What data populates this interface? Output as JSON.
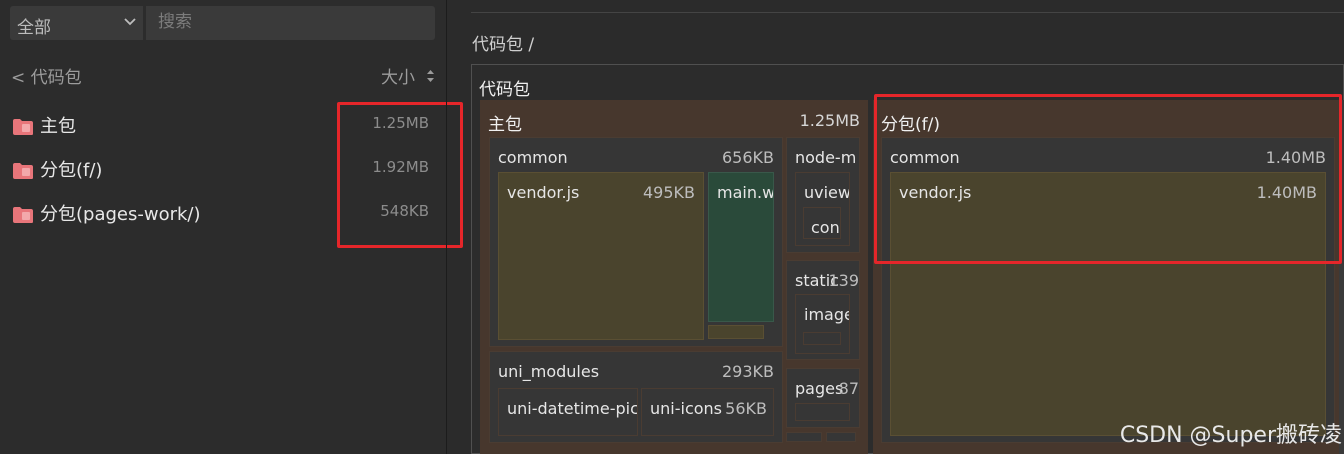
{
  "sidebar": {
    "filter_label": "全部",
    "search_placeholder": "搜索",
    "back_label": "< 代码包",
    "sort_label": "大小",
    "packages": [
      {
        "name": "主包",
        "size": "1.25MB"
      },
      {
        "name": "分包(f/)",
        "size": "1.92MB"
      },
      {
        "name": "分包(pages-work/)",
        "size": "548KB"
      }
    ]
  },
  "main": {
    "breadcrumb": "代码包 /",
    "treemap_title": "代码包",
    "main_pkg": {
      "label": "主包",
      "size": "1.25MB"
    },
    "common": {
      "label": "common",
      "size": "656KB"
    },
    "vendor": {
      "label": "vendor.js",
      "size": "495KB"
    },
    "mainw": {
      "label": "main.w"
    },
    "node_m": {
      "label": "node-m"
    },
    "uview": {
      "label": "uview"
    },
    "con": {
      "label": "con"
    },
    "static": {
      "label": "static",
      "size": "139"
    },
    "image": {
      "label": "image"
    },
    "pages": {
      "label": "pages",
      "size": "87"
    },
    "uni_modules": {
      "label": "uni_modules",
      "size": "293KB"
    },
    "uni_datetime": {
      "label": "uni-datetime-pic"
    },
    "uni_icons": {
      "label": "uni-icons",
      "size": "56KB"
    },
    "sub_f": {
      "label": "分包(f/)"
    },
    "sub_common": {
      "label": "common",
      "size": "1.40MB"
    },
    "sub_vendor": {
      "label": "vendor.js",
      "size": "1.40MB"
    }
  },
  "watermark": "CSDN @Super搬砖凌",
  "colors": {
    "highlight_red": "#e5262a",
    "folder_icon": "#e8757a",
    "main_pkg_bg": "#47372d",
    "vendor_bg": "#4a442d",
    "main_w_bg": "#2a4a3a"
  }
}
